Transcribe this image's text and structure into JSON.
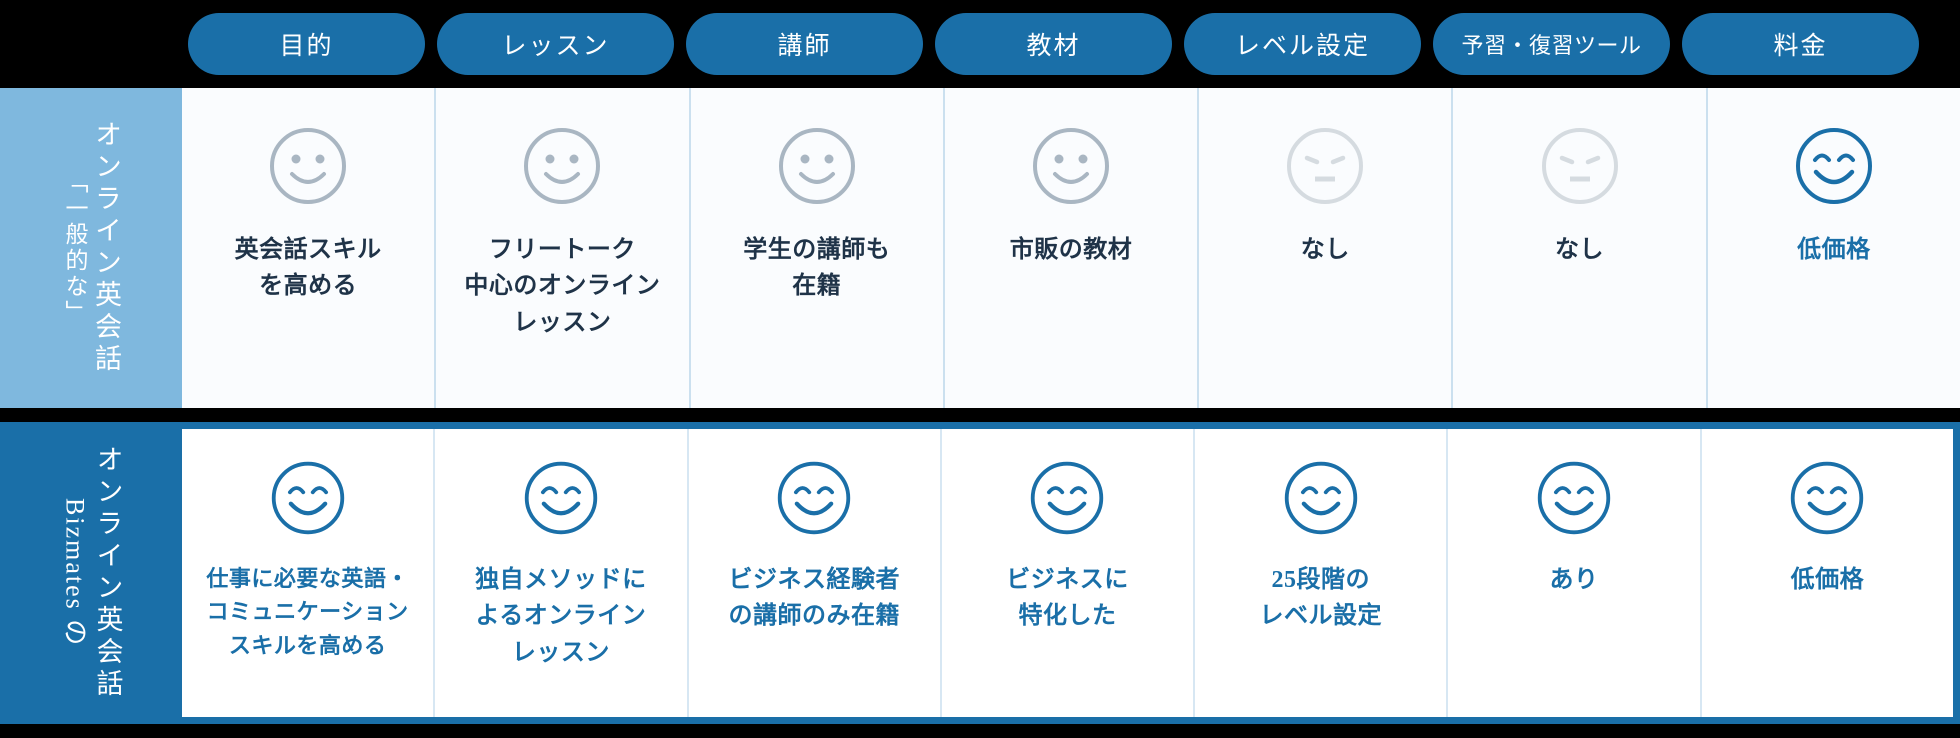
{
  "header": {
    "columns": [
      {
        "label": "目的"
      },
      {
        "label": "レッスン"
      },
      {
        "label": "講師"
      },
      {
        "label": "教材"
      },
      {
        "label": "レベル設定"
      },
      {
        "label": "予習・復習ツール"
      },
      {
        "label": "料金"
      }
    ]
  },
  "colors": {
    "pill_background": "#1a6FA8",
    "pill_text": "#ffffff",
    "row1_label_background": "#7FB8DE",
    "row1_cell_background": "#FAFCFE",
    "row1_divider": "#CBE0EF",
    "row1_text": "#1F3348",
    "row2_label_background": "#1a6FA8",
    "row2_cell_background": "#FFFFFF",
    "row2_border": "#1a6FA8",
    "row2_divider": "#D7E7F3",
    "row2_text": "#1a6FA8",
    "face_gray": "#A9B6C2",
    "face_light_gray": "#D5DBE0",
    "face_blue": "#1a6FA8",
    "page_background": "#000000"
  },
  "rows": [
    {
      "id": "generic",
      "label_lines": [
        "オンライン英会話",
        "「一般的な」"
      ],
      "label_color": "#ffffff",
      "cells": [
        {
          "icon": "smiley-neutral-gray-icon",
          "icon_style": "gray-smile",
          "text": "英会話スキル\nを高める"
        },
        {
          "icon": "smiley-neutral-gray-icon",
          "icon_style": "gray-smile",
          "text": "フリートーク\n中心のオンライン\nレッスン"
        },
        {
          "icon": "smiley-neutral-gray-icon",
          "icon_style": "gray-smile",
          "text": "学生の講師も\n在籍"
        },
        {
          "icon": "smiley-neutral-gray-icon",
          "icon_style": "gray-smile",
          "text": "市販の教材"
        },
        {
          "icon": "frowning-face-icon",
          "icon_style": "gray-sad",
          "text": "なし"
        },
        {
          "icon": "frowning-face-icon",
          "icon_style": "gray-sad",
          "text": "なし"
        },
        {
          "icon": "smiley-happy-blue-icon",
          "icon_style": "blue-happy",
          "text": "低価格",
          "highlight": true
        }
      ]
    },
    {
      "id": "bizmates",
      "label_lines": [
        "オンライン英会話",
        "Bizmates の"
      ],
      "label_color": "#ffffff",
      "cells": [
        {
          "icon": "smiley-happy-blue-icon",
          "icon_style": "blue-happy",
          "text": "仕事に必要な英語・\nコミュニケーション\nスキルを高める",
          "small": true
        },
        {
          "icon": "smiley-happy-blue-icon",
          "icon_style": "blue-happy",
          "text": "独自メソッドに\nよるオンライン\nレッスン"
        },
        {
          "icon": "smiley-happy-blue-icon",
          "icon_style": "blue-happy",
          "text": "ビジネス経験者\nの講師のみ在籍"
        },
        {
          "icon": "smiley-happy-blue-icon",
          "icon_style": "blue-happy",
          "text": "ビジネスに\n特化した"
        },
        {
          "icon": "smiley-happy-blue-icon",
          "icon_style": "blue-happy",
          "text": "25段階の\nレベル設定"
        },
        {
          "icon": "smiley-happy-blue-icon",
          "icon_style": "blue-happy",
          "text": "あり"
        },
        {
          "icon": "smiley-happy-blue-icon",
          "icon_style": "blue-happy",
          "text": "低価格"
        }
      ]
    }
  ]
}
